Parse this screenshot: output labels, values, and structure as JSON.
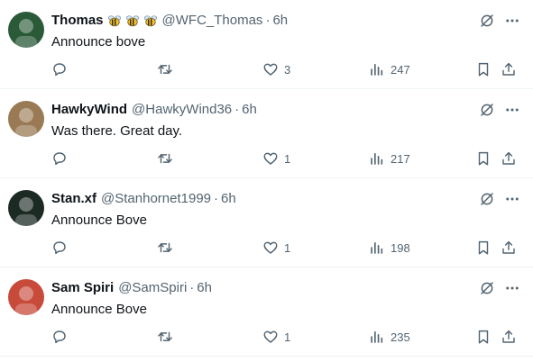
{
  "tweets": [
    {
      "name": "Thomas",
      "badges": [
        "bee-emoji",
        "bee-emoji",
        "bee-emoji"
      ],
      "handle": "@WFC_Thomas",
      "separator": "·",
      "time": "6h",
      "text": "Announce bove",
      "replies": "",
      "retweets": "",
      "likes": "3",
      "views": "247",
      "avatar_color": "#2a5a38"
    },
    {
      "name": "HawkyWind",
      "badges": [],
      "handle": "@HawkyWind36",
      "separator": "·",
      "time": "6h",
      "text": "Was there. Great day.",
      "replies": "",
      "retweets": "",
      "likes": "1",
      "views": "217",
      "avatar_color": "#9a7a55"
    },
    {
      "name": "Stan.xf",
      "badges": [],
      "handle": "@Stanhornet1999",
      "separator": "·",
      "time": "6h",
      "text": "Announce Bove",
      "replies": "",
      "retweets": "",
      "likes": "1",
      "views": "198",
      "avatar_color": "#1c2a24"
    },
    {
      "name": "Sam Spiri",
      "badges": [],
      "handle": "@SamSpiri",
      "separator": "·",
      "time": "6h",
      "text": "Announce Bove",
      "replies": "",
      "retweets": "",
      "likes": "1",
      "views": "235",
      "avatar_color": "#c84a3a"
    }
  ],
  "icons": {
    "top": [
      "grok-icon",
      "more-icon"
    ],
    "actions": [
      "reply-icon",
      "retweet-icon",
      "like-icon",
      "views-icon",
      "bookmark-icon",
      "share-icon"
    ]
  },
  "colors": {
    "text": "#0f1419",
    "secondary": "#536471",
    "divider": "#eff3f4"
  }
}
